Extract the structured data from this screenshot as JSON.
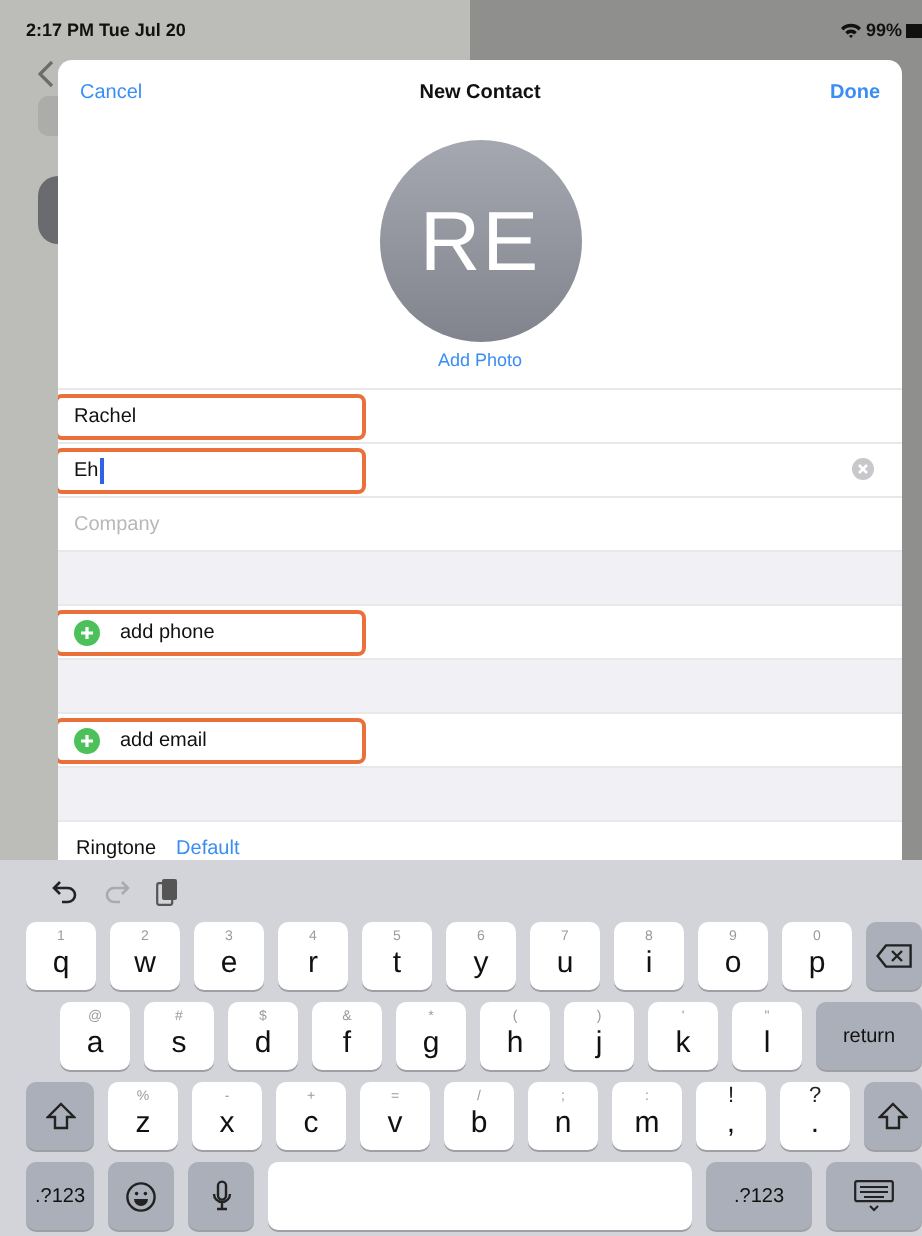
{
  "status_bar": {
    "time": "2:17 PM  Tue Jul 20",
    "battery": "99%"
  },
  "sheet": {
    "cancel": "Cancel",
    "title": "New Contact",
    "done": "Done",
    "avatar_initials": "RE",
    "add_photo": "Add Photo"
  },
  "fields": [
    {
      "kind": "text",
      "value": "Rachel",
      "highlighted": true
    },
    {
      "kind": "text",
      "value": "Eh",
      "focused": true,
      "highlighted": true
    },
    {
      "kind": "text",
      "placeholder": "Company",
      "highlighted": false
    },
    {
      "kind": "gap"
    },
    {
      "kind": "add",
      "label": "add phone",
      "highlighted": true
    },
    {
      "kind": "gap"
    },
    {
      "kind": "add",
      "label": "add email",
      "highlighted": true
    },
    {
      "kind": "gap"
    },
    {
      "kind": "setting",
      "label": "Ringtone",
      "value": "Default"
    }
  ],
  "keyboard": {
    "toolbar": [
      {
        "kind": "undo",
        "disabled": false
      },
      {
        "kind": "redo",
        "disabled": true
      },
      {
        "kind": "paste",
        "disabled": false
      }
    ],
    "rows": [
      {
        "keys": [
          {
            "kind": "letter",
            "label": "q",
            "hint": "1"
          },
          {
            "kind": "letter",
            "label": "w",
            "hint": "2"
          },
          {
            "kind": "letter",
            "label": "e",
            "hint": "3"
          },
          {
            "kind": "letter",
            "label": "r",
            "hint": "4"
          },
          {
            "kind": "letter",
            "label": "t",
            "hint": "5"
          },
          {
            "kind": "letter",
            "label": "y",
            "hint": "6"
          },
          {
            "kind": "letter",
            "label": "u",
            "hint": "7"
          },
          {
            "kind": "letter",
            "label": "i",
            "hint": "8"
          },
          {
            "kind": "letter",
            "label": "o",
            "hint": "9"
          },
          {
            "kind": "letter",
            "label": "p",
            "hint": "0"
          },
          {
            "kind": "backspace"
          }
        ]
      },
      {
        "keys": [
          {
            "kind": "letter",
            "label": "a",
            "hint": "@"
          },
          {
            "kind": "letter",
            "label": "s",
            "hint": "#"
          },
          {
            "kind": "letter",
            "label": "d",
            "hint": "$"
          },
          {
            "kind": "letter",
            "label": "f",
            "hint": "&"
          },
          {
            "kind": "letter",
            "label": "g",
            "hint": "*"
          },
          {
            "kind": "letter",
            "label": "h",
            "hint": "("
          },
          {
            "kind": "letter",
            "label": "j",
            "hint": ")"
          },
          {
            "kind": "letter",
            "label": "k",
            "hint": "'"
          },
          {
            "kind": "letter",
            "label": "l",
            "hint": "\""
          },
          {
            "kind": "return",
            "label": "return"
          }
        ]
      },
      {
        "keys": [
          {
            "kind": "shift"
          },
          {
            "kind": "letter",
            "label": "z",
            "hint": "%"
          },
          {
            "kind": "letter",
            "label": "x",
            "hint": "-"
          },
          {
            "kind": "letter",
            "label": "c",
            "hint": "+"
          },
          {
            "kind": "letter",
            "label": "v",
            "hint": "="
          },
          {
            "kind": "letter",
            "label": "b",
            "hint": "/"
          },
          {
            "kind": "letter",
            "label": "n",
            "hint": ";"
          },
          {
            "kind": "letter",
            "label": "m",
            "hint": ":"
          },
          {
            "kind": "punct",
            "label": ",",
            "hint": "!"
          },
          {
            "kind": "punct",
            "label": ".",
            "hint": "?"
          },
          {
            "kind": "shift"
          }
        ]
      },
      {
        "keys": [
          {
            "kind": "mode",
            "label": ".?123"
          },
          {
            "kind": "emoji"
          },
          {
            "kind": "mic"
          },
          {
            "kind": "space"
          },
          {
            "kind": "mode",
            "label": ".?123"
          },
          {
            "kind": "hide"
          }
        ]
      }
    ]
  }
}
